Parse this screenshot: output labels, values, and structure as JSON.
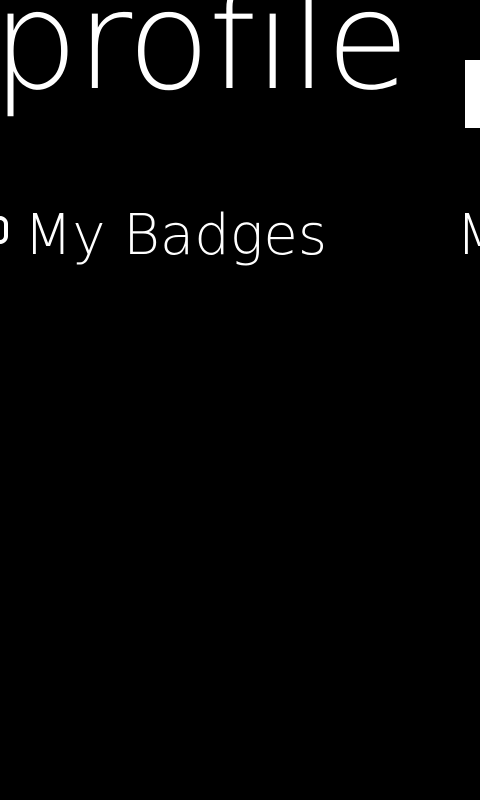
{
  "panorama": {
    "title": "profile"
  },
  "pivot": {
    "active_label": "My Badges",
    "next_label_fragment": "M"
  }
}
